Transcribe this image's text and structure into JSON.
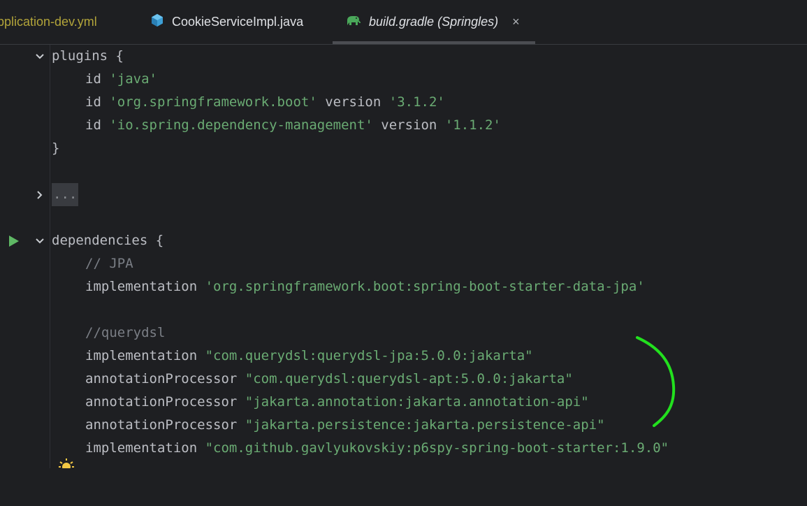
{
  "tabs": [
    {
      "label": "pplication-dev.yml",
      "icon": "yaml-file-icon",
      "state": "modified"
    },
    {
      "label": "CookieServiceImpl.java",
      "icon": "java-class-icon",
      "state": "normal"
    },
    {
      "label": "build.gradle (Springles)",
      "icon": "gradle-elephant-icon",
      "state": "active",
      "close": "×"
    }
  ],
  "code": {
    "plugins_open": "plugins {",
    "id1_kw": "id",
    "id1_str": "'java'",
    "id2_kw": "id",
    "id2_str": "'org.springframework.boot'",
    "id2_ver_kw": "version",
    "id2_ver": "'3.1.2'",
    "id3_kw": "id",
    "id3_str": "'io.spring.dependency-management'",
    "id3_ver_kw": "version",
    "id3_ver": "'1.1.2'",
    "close1": "}",
    "folded": "...",
    "deps_open": "dependencies {",
    "cmt_jpa": "// JPA",
    "impl1_kw": "implementation",
    "impl1_str": "'org.springframework.boot:spring-boot-starter-data-jpa'",
    "cmt_querydsl": "//querydsl",
    "impl2_kw": "implementation",
    "impl2_str": "\"com.querydsl:querydsl-jpa:5.0.0:jakarta\"",
    "ap1_kw": "annotationProcessor",
    "ap1_str": "\"com.querydsl:querydsl-apt:5.0.0:jakarta\"",
    "ap2_kw": "annotationProcessor",
    "ap2_str": "\"jakarta.annotation:jakarta.annotation-api\"",
    "ap3_kw": "annotationProcessor",
    "ap3_str": "\"jakarta.persistence:jakarta.persistence-api\"",
    "impl3_kw": "implementation",
    "impl3_str": "\"com.github.gavlyukovskiy:p6spy-spring-boot-starter:1.9.0\""
  },
  "gutter": {
    "fold_open_icon": "chevron-down-icon",
    "fold_closed_icon": "chevron-right-icon",
    "run_icon": "run-triangle-icon",
    "bulb_icon": "lightbulb-icon"
  },
  "colors": {
    "background": "#1e1f22",
    "keyword": "#bcbec4",
    "string": "#6aab73",
    "comment": "#7a7e85",
    "run": "#5fb865",
    "annotation_stroke": "#22e01e"
  }
}
